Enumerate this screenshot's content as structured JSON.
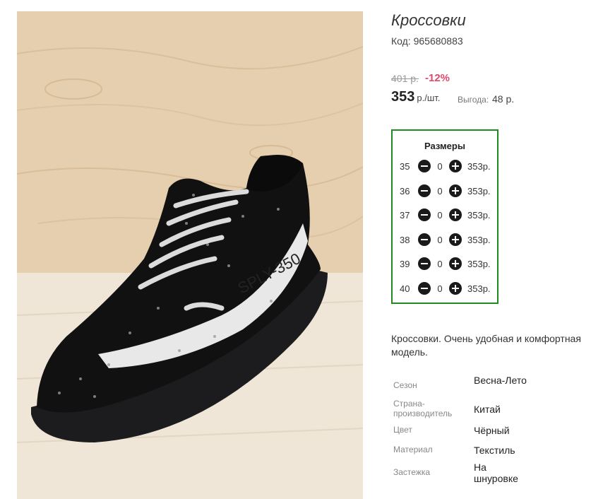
{
  "product": {
    "title": "Кроссовки",
    "code": "Код: 965680883",
    "old_price": "401 р.",
    "discount": "-12%",
    "price": "353",
    "unit": "р./шт.",
    "saving_label": "Выгода:",
    "saving_value": "48 р."
  },
  "sizes": {
    "title": "Размеры",
    "rows": [
      {
        "size": "35",
        "qty": "0",
        "price": "353р."
      },
      {
        "size": "36",
        "qty": "0",
        "price": "353р."
      },
      {
        "size": "37",
        "qty": "0",
        "price": "353р."
      },
      {
        "size": "38",
        "qty": "0",
        "price": "353р."
      },
      {
        "size": "39",
        "qty": "0",
        "price": "353р."
      },
      {
        "size": "40",
        "qty": "0",
        "price": "353р."
      }
    ]
  },
  "description": "Кроссовки. Очень удобная и комфортная модель.",
  "properties": [
    {
      "label": "Сезон",
      "value": "Весна-Лето"
    },
    {
      "label": "Страна-производитель",
      "value": "Китай"
    },
    {
      "label": "Цвет",
      "value": "Чёрный"
    },
    {
      "label": "Материал",
      "value": "Текстиль"
    },
    {
      "label": "Застежка",
      "value": "На шнуровке"
    }
  ],
  "image": {
    "icon": "sneaker-photo",
    "side_text": "SPLY-350"
  },
  "colors": {
    "accent": "#e2476a",
    "frame": "#1e8c1e"
  }
}
